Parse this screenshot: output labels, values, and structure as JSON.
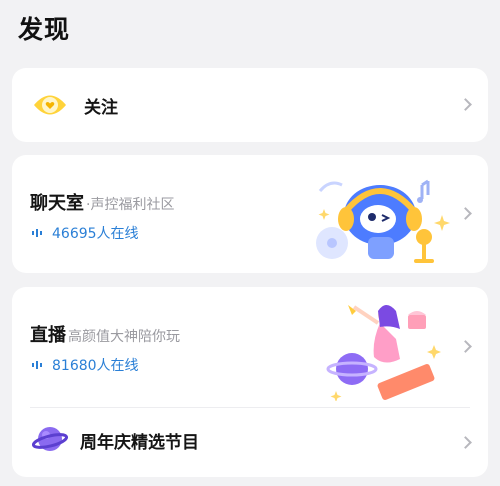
{
  "page": {
    "title": "发现"
  },
  "follow": {
    "label": "关注"
  },
  "chatroom": {
    "title": "聊天室",
    "subtitle": "·声控福利社区",
    "online": "46695人在线"
  },
  "live": {
    "title": "直播",
    "subtitle": "高颜值大神陪你玩",
    "online": "81680人在线"
  },
  "anniversary": {
    "label": "周年庆精选节目"
  },
  "colors": {
    "accent_blue": "#2a7fd6",
    "eye_yellow": "#ffd33a",
    "planet_purple": "#8a6af0"
  },
  "icons": {
    "follow": "eye-heart-icon",
    "anniversary": "planet-icon",
    "chevron": "chevron-right-icon",
    "online": "sound-wave-icon"
  }
}
